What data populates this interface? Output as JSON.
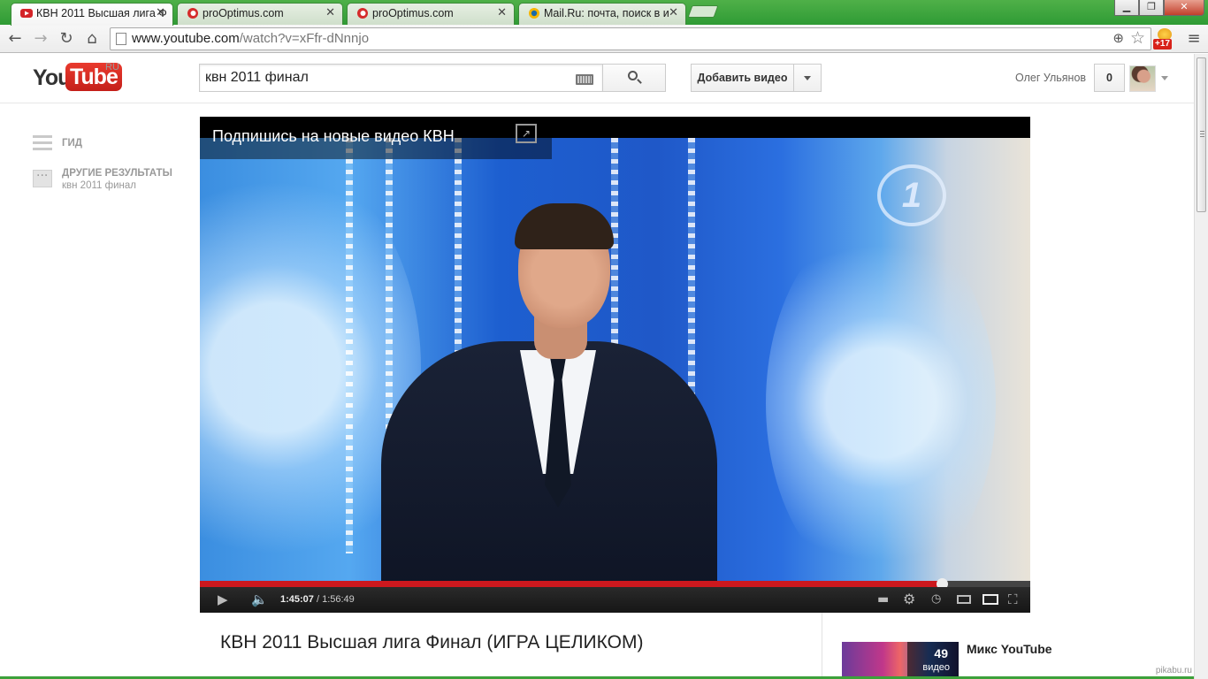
{
  "browser": {
    "tabs": [
      {
        "title": "КВН 2011 Высшая лига Ф",
        "active": true,
        "icon": "youtube-icon"
      },
      {
        "title": "proOptimus.com",
        "active": false,
        "icon": "site-icon"
      },
      {
        "title": "proOptimus.com",
        "active": false,
        "icon": "site-icon"
      },
      {
        "title": "Mail.Ru: почта, поиск в и",
        "active": false,
        "icon": "mail-icon"
      }
    ],
    "tab_close": "✕",
    "window": {
      "minimize": "▁",
      "restore": "❐",
      "close": "✕"
    },
    "nav": {
      "back": "←",
      "forward": "→",
      "reload": "↻",
      "home": "⌂",
      "wrench": "≡"
    },
    "address": {
      "host": "www.youtube.com",
      "path": "/watch?v=xFfr-dNnnjo"
    },
    "extension_badge": "+17",
    "accent": "#2f9b35"
  },
  "youtube": {
    "logo": {
      "you": "You",
      "tube": "Tube",
      "region": "RU"
    },
    "search": {
      "query": "квн 2011 финал"
    },
    "upload_label": "Добавить видео",
    "user": {
      "name": "Олег Ульянов",
      "notifications": "0"
    },
    "guide": {
      "guide_label": "ГИД",
      "other_results_label": "ДРУГИЕ РЕЗУЛЬТАТЫ",
      "other_results_query": "квн 2011 финал"
    },
    "player": {
      "overlay_title": "Подпишись на новые видео КВН",
      "channel_logo": "1",
      "current_time": "1:45:07",
      "separator": " / ",
      "duration": "1:56:49",
      "progress_fraction": 0.893,
      "progress_color": "#cc181e"
    },
    "video_title": "КВН 2011 Высшая лига Финал (ИГРА ЦЕЛИКОМ)",
    "related": {
      "count": "49",
      "count_label": "видео",
      "title": "Микс YouTube"
    },
    "watermark": "pikabu.ru"
  }
}
